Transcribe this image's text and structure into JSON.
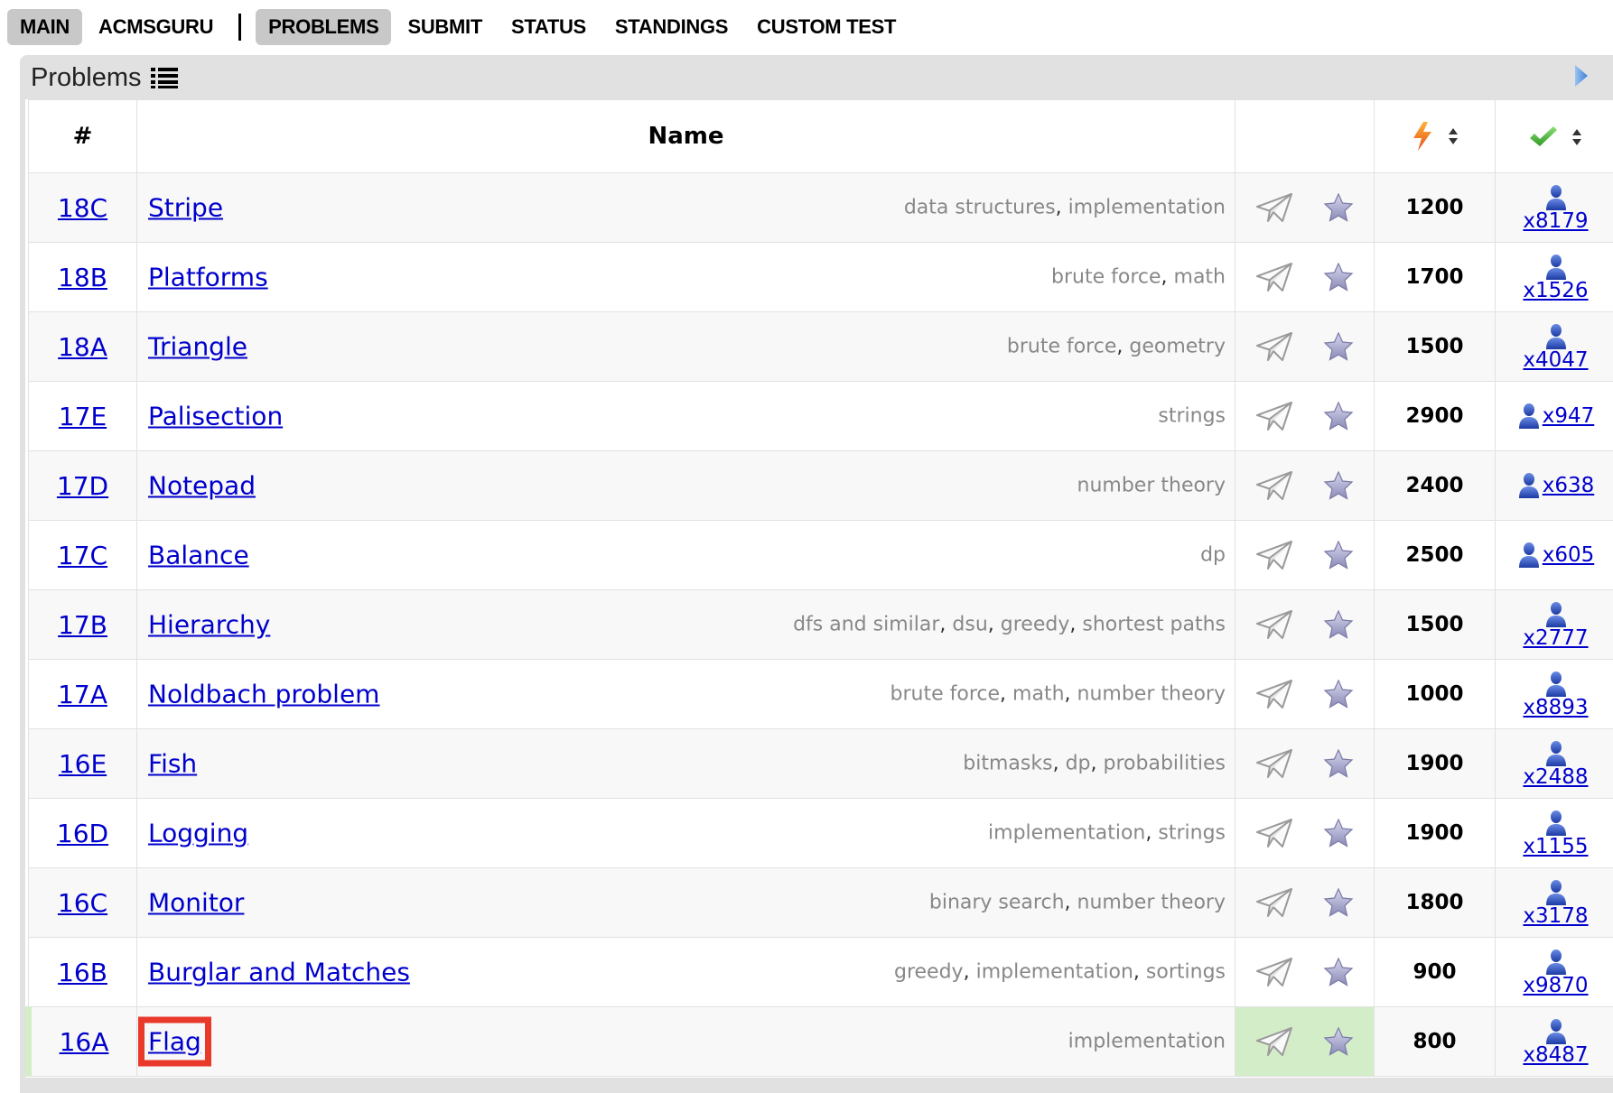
{
  "menu": {
    "items": [
      {
        "label": "MAIN",
        "active": true
      },
      {
        "label": "ACMSGURU",
        "active": false
      },
      {
        "label": "PROBLEMS",
        "active": true
      },
      {
        "label": "SUBMIT",
        "active": false
      },
      {
        "label": "STATUS",
        "active": false
      },
      {
        "label": "STANDINGS",
        "active": false
      },
      {
        "label": "CUSTOM TEST",
        "active": false
      }
    ]
  },
  "box": {
    "title": "Problems"
  },
  "table": {
    "headers": {
      "id": "#",
      "name": "Name"
    },
    "rows": [
      {
        "id": "18C",
        "name": "Stripe",
        "tags": [
          "data structures",
          "implementation"
        ],
        "rating": "1200",
        "solved": "x8179",
        "layout": "stack"
      },
      {
        "id": "18B",
        "name": "Platforms",
        "tags": [
          "brute force",
          "math"
        ],
        "rating": "1700",
        "solved": "x1526",
        "layout": "stack"
      },
      {
        "id": "18A",
        "name": "Triangle",
        "tags": [
          "brute force",
          "geometry"
        ],
        "rating": "1500",
        "solved": "x4047",
        "layout": "stack"
      },
      {
        "id": "17E",
        "name": "Palisection",
        "tags": [
          "strings"
        ],
        "rating": "2900",
        "solved": "x947",
        "layout": "inline"
      },
      {
        "id": "17D",
        "name": "Notepad",
        "tags": [
          "number theory"
        ],
        "rating": "2400",
        "solved": "x638",
        "layout": "inline"
      },
      {
        "id": "17C",
        "name": "Balance",
        "tags": [
          "dp"
        ],
        "rating": "2500",
        "solved": "x605",
        "layout": "inline"
      },
      {
        "id": "17B",
        "name": "Hierarchy",
        "tags": [
          "dfs and similar",
          "dsu",
          "greedy",
          "shortest paths"
        ],
        "rating": "1500",
        "solved": "x2777",
        "layout": "stack"
      },
      {
        "id": "17A",
        "name": "Noldbach problem",
        "tags": [
          "brute force",
          "math",
          "number theory"
        ],
        "rating": "1000",
        "solved": "x8893",
        "layout": "stack"
      },
      {
        "id": "16E",
        "name": "Fish",
        "tags": [
          "bitmasks",
          "dp",
          "probabilities"
        ],
        "rating": "1900",
        "solved": "x2488",
        "layout": "stack"
      },
      {
        "id": "16D",
        "name": "Logging",
        "tags": [
          "implementation",
          "strings"
        ],
        "rating": "1900",
        "solved": "x1155",
        "layout": "stack"
      },
      {
        "id": "16C",
        "name": "Monitor",
        "tags": [
          "binary search",
          "number theory"
        ],
        "rating": "1800",
        "solved": "x3178",
        "layout": "stack"
      },
      {
        "id": "16B",
        "name": "Burglar and Matches",
        "tags": [
          "greedy",
          "implementation",
          "sortings"
        ],
        "rating": "900",
        "solved": "x9870",
        "layout": "stack"
      },
      {
        "id": "16A",
        "name": "Flag",
        "tags": [
          "implementation"
        ],
        "rating": "800",
        "solved": "x8487",
        "layout": "stack",
        "accepted": true,
        "highlight": true
      }
    ]
  },
  "colors": {
    "link": "#0000cc",
    "accepted_bg": "#d4edc9",
    "highlight": "#e8392a",
    "menu_active_bg": "#c8c8c8"
  },
  "icons": {
    "title": "list-icon",
    "toggle": "triangle-right-icon",
    "rating_header": "lightning-icon",
    "solved_header": "checkmark-icon",
    "submit": "paper-plane-icon",
    "favourite": "star-icon",
    "solved": "user-icon"
  }
}
